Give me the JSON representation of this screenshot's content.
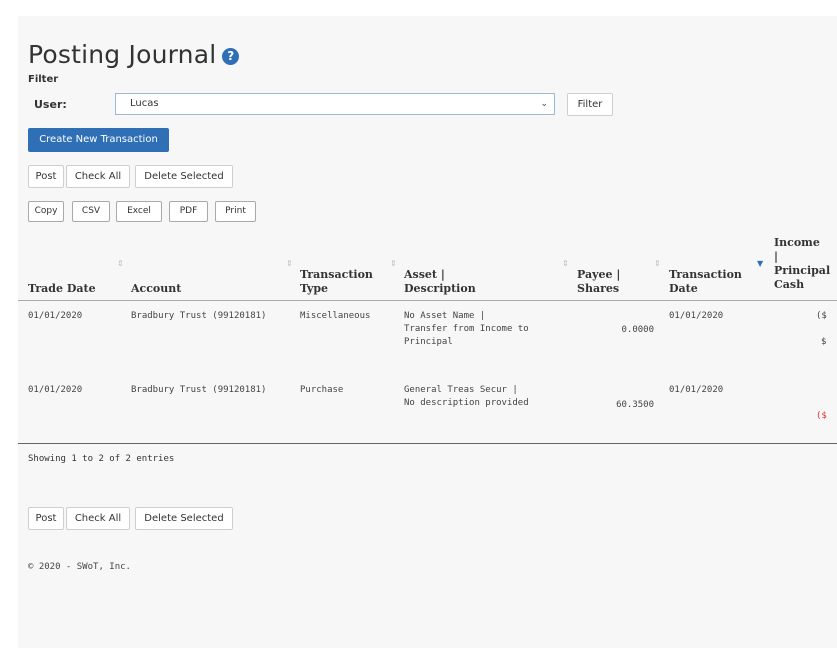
{
  "header": {
    "title": "Posting Journal",
    "help_icon": "?"
  },
  "filter": {
    "section_label": "Filter",
    "user_label": "User:",
    "user_value": "Lucas",
    "filter_button": "Filter"
  },
  "actions": {
    "create_button": "Create New Transaction",
    "post": "Post",
    "check_all": "Check All",
    "delete_selected": "Delete Selected"
  },
  "export": {
    "copy": "Copy",
    "csv": "CSV",
    "excel": "Excel",
    "pdf": "PDF",
    "print": "Print"
  },
  "table": {
    "columns": {
      "trade_date": "Trade Date",
      "account": "Account",
      "transaction_type_1": "Transaction",
      "transaction_type_2": "Type",
      "asset_1": "Asset |",
      "asset_2": "Description",
      "payee_1": "Payee |",
      "payee_2": "Shares",
      "transaction_date_1": "Transaction",
      "transaction_date_2": "Date",
      "income_1": "Income",
      "income_2": "|",
      "income_3": "Principal",
      "income_4": "Cash"
    },
    "rows": [
      {
        "trade_date": "01/01/2020",
        "account": "Bradbury Trust (99120181)",
        "transaction_type": "Miscellaneous",
        "asset_line1": "No Asset Name |",
        "asset_line2": "Transfer from Income to",
        "asset_line3": "Principal",
        "shares": "0.0000",
        "transaction_date": "01/01/2020",
        "cash_line1": "($",
        "cash_line2": "$"
      },
      {
        "trade_date": "01/01/2020",
        "account": "Bradbury Trust (99120181)",
        "transaction_type": "Purchase",
        "asset_line1": "General Treas Secur |",
        "asset_line2": "No description provided",
        "shares": "60.3500",
        "transaction_date": "01/01/2020",
        "cash_line1": "($"
      }
    ]
  },
  "info": "Showing 1 to 2 of 2 entries",
  "footer": "© 2020 - SWoT, Inc.",
  "colors": {
    "primary": "#2f6fb6",
    "negative": "#d33333"
  }
}
